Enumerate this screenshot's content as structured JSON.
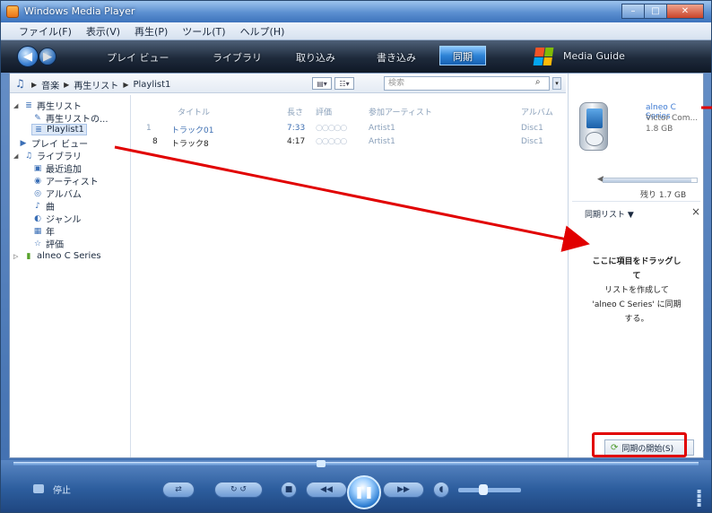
{
  "window": {
    "title": "Windows Media Player"
  },
  "menu": [
    "ファイル(F)",
    "表示(V)",
    "再生(P)",
    "ツール(T)",
    "ヘルプ(H)"
  ],
  "tabs": {
    "now_playing": "プレイ ビュー",
    "library": "ライブラリ",
    "rip": "取り込み",
    "burn": "書き込み",
    "sync": "同期",
    "guide": "Media Guide",
    "active": "sync"
  },
  "breadcrumb": [
    "音楽",
    "再生リスト",
    "Playlist1"
  ],
  "search": {
    "placeholder": "検索"
  },
  "tree": {
    "playlists": "再生リスト",
    "create_playlist": "再生リストの...",
    "playlist1": "Playlist1",
    "now_playing": "プレイ ビュー",
    "library": "ライブラリ",
    "recently_added": "最近追加",
    "artist": "アーティスト",
    "album": "アルバム",
    "songs": "曲",
    "genre": "ジャンル",
    "year": "年",
    "rating": "評価",
    "device": "alneo C Series"
  },
  "columns": {
    "title": "タイトル",
    "length": "長さ",
    "rating": "評価",
    "artist": "参加アーティスト",
    "album": "アルバム"
  },
  "tracks": [
    {
      "num": "1",
      "title": "トラック01",
      "length": "7:33",
      "rating": "○○○○○",
      "artist": "Artist1",
      "album": "Disc1"
    },
    {
      "num": "8",
      "title": "トラック8",
      "length": "4:17",
      "rating": "○○○○○",
      "artist": "Artist1",
      "album": "Disc1"
    }
  ],
  "device": {
    "name": "alneo C Series",
    "maker": "Victor Com...",
    "capacity": "1.8 GB",
    "remaining": "残り 1.7 GB",
    "remaining_fraction": 0.94
  },
  "sync_panel": {
    "list_label": "同期リスト",
    "close": "×",
    "msg_bold_1": "ここに項目をドラッグし",
    "msg_bold_2": "て",
    "msg_1": "リストを作成して",
    "msg_2": "'alneo C Series' に同期",
    "msg_3": "する。",
    "start_button": "同期の開始(S)"
  },
  "player": {
    "status": "停止"
  },
  "colors": {
    "annotation": "#e10000",
    "accent": "#2e83d6"
  }
}
